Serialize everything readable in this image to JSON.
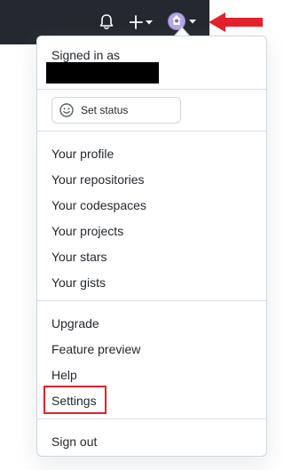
{
  "topbar": {
    "bell_icon": "bell-icon",
    "plus_icon": "plus-icon",
    "avatar_icon": "user-avatar",
    "background": "#24292f"
  },
  "annotation": {
    "arrow_color": "#e5202a",
    "highlight_color": "#e5202a"
  },
  "dropdown": {
    "signed_in_label": "Signed in as",
    "status_label": "Set status",
    "status_icon": "smiley-icon",
    "group1": [
      "Your profile",
      "Your repositories",
      "Your codespaces",
      "Your projects",
      "Your stars",
      "Your gists"
    ],
    "group2": [
      "Upgrade",
      "Feature preview",
      "Help",
      "Settings"
    ],
    "signout": "Sign out"
  }
}
